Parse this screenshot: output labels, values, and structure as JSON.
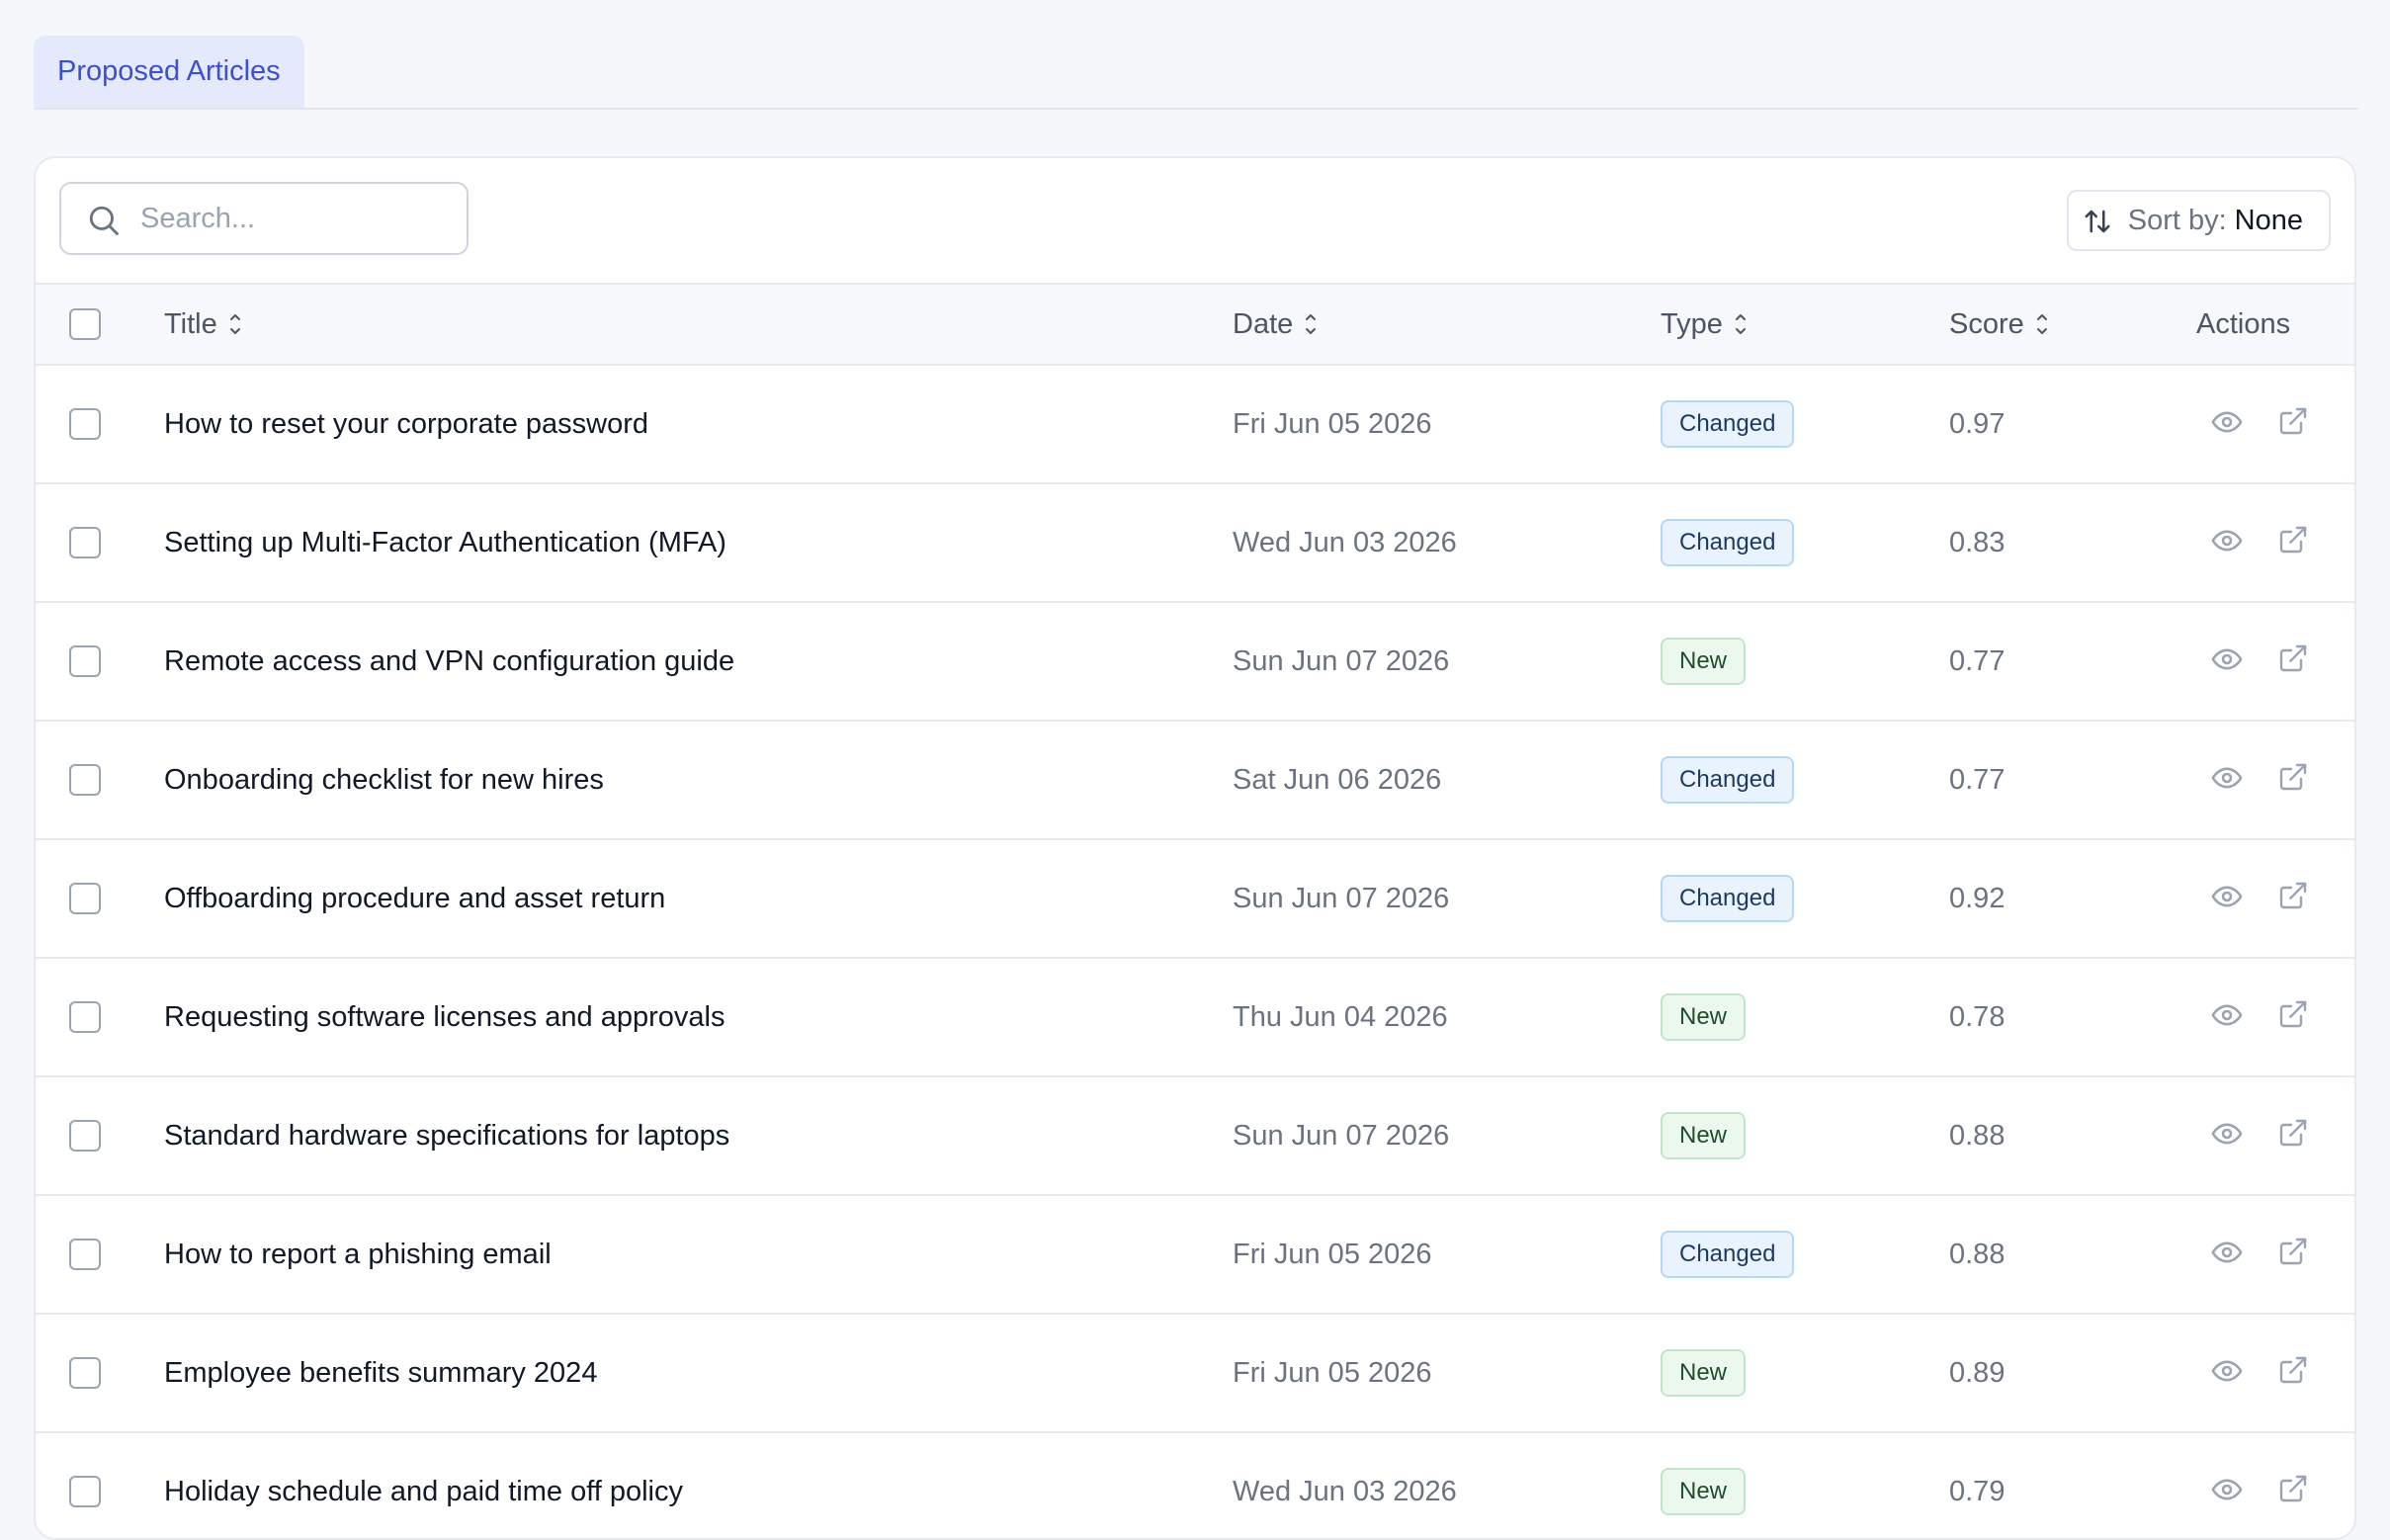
{
  "tabs": [
    {
      "label": "Proposed Articles"
    }
  ],
  "search": {
    "placeholder": "Search...",
    "value": ""
  },
  "sort": {
    "label": "Sort by:",
    "value": "None"
  },
  "columns": {
    "title": "Title",
    "date": "Date",
    "type": "Type",
    "score": "Score",
    "actions": "Actions"
  },
  "rows": [
    {
      "title": "How to reset your corporate password",
      "date": "Fri Jun 05 2026",
      "type": "Changed",
      "score": "0.97"
    },
    {
      "title": "Setting up Multi-Factor Authentication (MFA)",
      "date": "Wed Jun 03 2026",
      "type": "Changed",
      "score": "0.83"
    },
    {
      "title": "Remote access and VPN configuration guide",
      "date": "Sun Jun 07 2026",
      "type": "New",
      "score": "0.77"
    },
    {
      "title": "Onboarding checklist for new hires",
      "date": "Sat Jun 06 2026",
      "type": "Changed",
      "score": "0.77"
    },
    {
      "title": "Offboarding procedure and asset return",
      "date": "Sun Jun 07 2026",
      "type": "Changed",
      "score": "0.92"
    },
    {
      "title": "Requesting software licenses and approvals",
      "date": "Thu Jun 04 2026",
      "type": "New",
      "score": "0.78"
    },
    {
      "title": "Standard hardware specifications for laptops",
      "date": "Sun Jun 07 2026",
      "type": "New",
      "score": "0.88"
    },
    {
      "title": "How to report a phishing email",
      "date": "Fri Jun 05 2026",
      "type": "Changed",
      "score": "0.88"
    },
    {
      "title": "Employee benefits summary 2024",
      "date": "Fri Jun 05 2026",
      "type": "New",
      "score": "0.89"
    },
    {
      "title": "Holiday schedule and paid time off policy",
      "date": "Wed Jun 03 2026",
      "type": "New",
      "score": "0.79"
    }
  ],
  "icons": {
    "search": "search-icon",
    "sort": "sort-arrows-icon",
    "view": "eye-icon",
    "open": "external-link-icon"
  },
  "colors": {
    "accent": "#3b4fd1",
    "changed_bg": "#e8f3fd",
    "new_bg": "#ebf8ee"
  }
}
